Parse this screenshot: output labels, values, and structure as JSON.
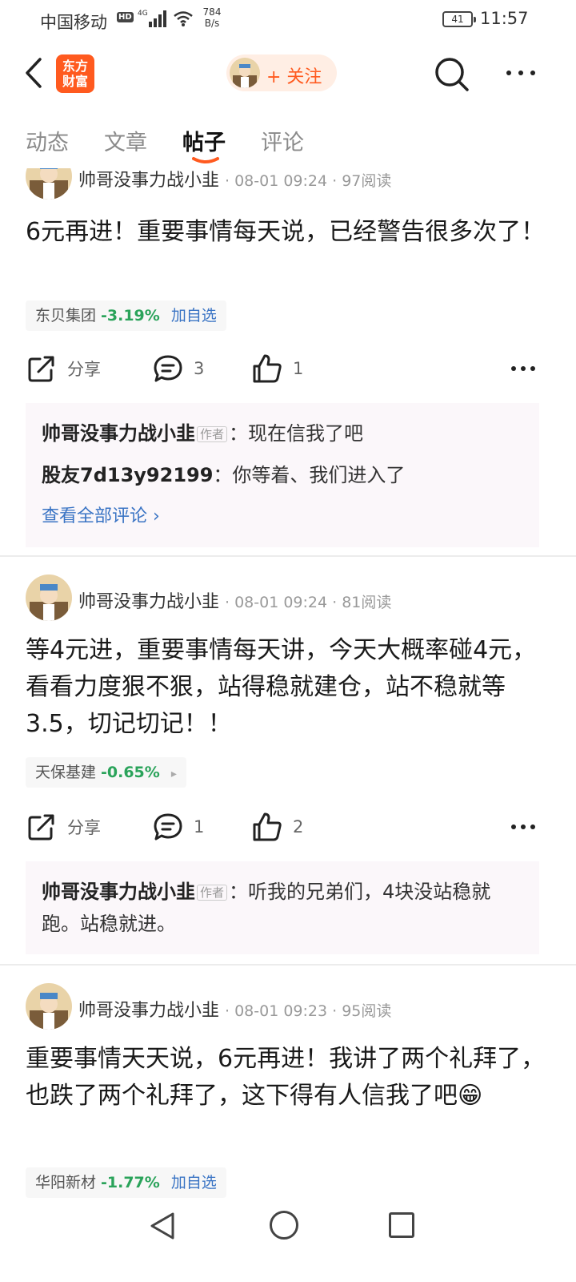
{
  "status_bar": {
    "carrier": "中国移动",
    "hd_badge": "HD",
    "network": "4G",
    "speed_value": "784",
    "speed_unit": "B/s",
    "battery": "41",
    "time": "11:57"
  },
  "top_nav": {
    "logo_text_line1": "东方",
    "logo_text_line2": "财富",
    "follow_label": "+ 关注"
  },
  "tabs": [
    {
      "label": "动态",
      "active": false
    },
    {
      "label": "文章",
      "active": false
    },
    {
      "label": "帖子",
      "active": true
    },
    {
      "label": "评论",
      "active": false
    }
  ],
  "posts": [
    {
      "author": "帅哥没事力战小韭",
      "meta": "· 08-01 09:24 · 97阅读",
      "text": "6元再进！重要事情每天说，已经警告很多次了！",
      "stock": {
        "name": "东贝集团",
        "change": "-3.19%",
        "action": "加自选"
      },
      "share_label": "分享",
      "comment_count": "3",
      "like_count": "1",
      "comments": [
        {
          "author": "帅哥没事力战小韭",
          "badge": "作者",
          "text": "：现在信我了吧"
        },
        {
          "author": "股友7d13y92199",
          "badge": "",
          "text": "：你等着、我们进入了"
        }
      ],
      "view_all": "查看全部评论 ›"
    },
    {
      "author": "帅哥没事力战小韭",
      "meta": "· 08-01 09:24 · 81阅读",
      "text": "等4元进，重要事情每天讲，今天大概率碰4元，看看力度狠不狠，站得稳就建仓，站不稳就等3.5，切记切记！！",
      "stock": {
        "name": "天保基建",
        "change": "-0.65%",
        "action": "▸"
      },
      "share_label": "分享",
      "comment_count": "1",
      "like_count": "2",
      "comments": [
        {
          "author": "帅哥没事力战小韭",
          "badge": "作者",
          "text": "：听我的兄弟们，4块没站稳就跑。站稳就进。"
        }
      ]
    },
    {
      "author": "帅哥没事力战小韭",
      "meta": "· 08-01 09:23 · 95阅读",
      "text": "重要事情天天说，6元再进！我讲了两个礼拜了，也跌了两个礼拜了，这下得有人信我了吧😁",
      "stock": {
        "name": "华阳新材",
        "change": "-1.77%",
        "action": "加自选"
      }
    }
  ],
  "colors": {
    "brand": "#ff5a1f",
    "down": "#2aa35a",
    "link": "#3a74c4",
    "comment_bg": "#fbf7fa"
  }
}
